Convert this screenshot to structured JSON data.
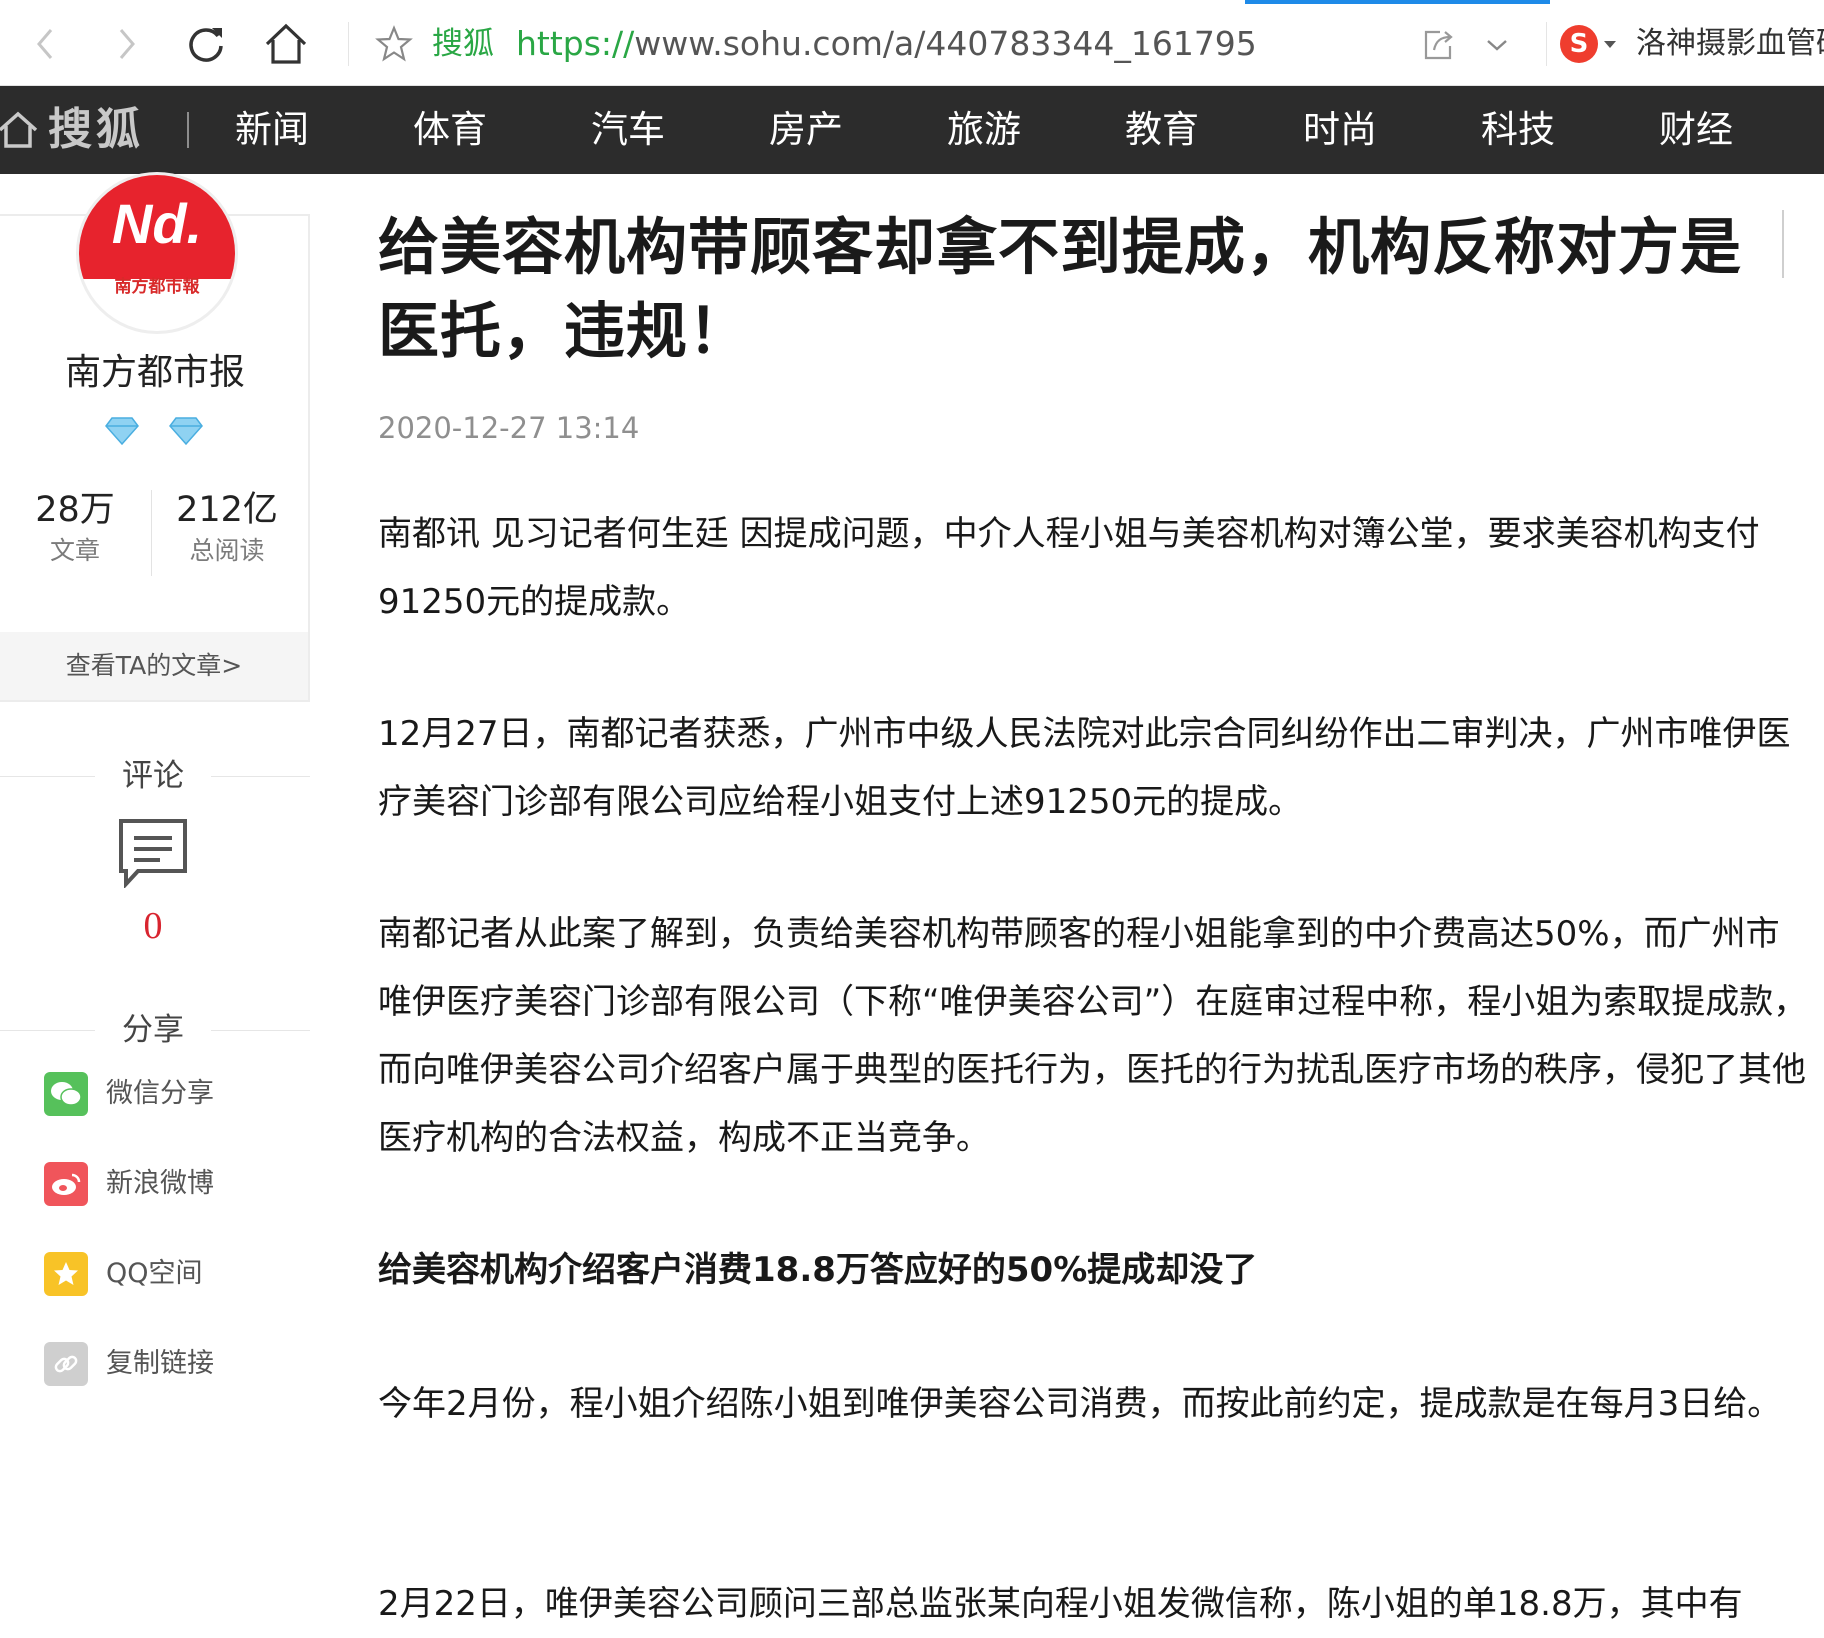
{
  "browser": {
    "site_name": "搜狐",
    "url_scheme": "https://",
    "url_rest": "www.sohu.com/a/440783344_161795",
    "search_text": "洛神摄影血管砥",
    "icons": [
      "back-icon",
      "forward-icon",
      "reload-icon",
      "home-icon",
      "star-icon",
      "share-icon",
      "chevron-down-icon",
      "sogou-icon"
    ],
    "colors": {
      "site_green": "#2aa745",
      "progress_blue": "#1e8ae8",
      "sogou_red": "#ef3d2e"
    }
  },
  "nav": {
    "logo": "搜狐",
    "items": [
      {
        "label": "新闻"
      },
      {
        "label": "体育"
      },
      {
        "label": "汽车"
      },
      {
        "label": "房产"
      },
      {
        "label": "旅游"
      },
      {
        "label": "教育"
      },
      {
        "label": "时尚"
      },
      {
        "label": "科技"
      },
      {
        "label": "财经"
      }
    ],
    "background": "#2c2c2c"
  },
  "author": {
    "avatar_mark": "Nd.",
    "avatar_subtitle": "南方都市報",
    "name": "南方都市报",
    "badge_count": 2,
    "stats": [
      {
        "value": "28万",
        "label": "文章"
      },
      {
        "value": "212亿",
        "label": "总阅读"
      }
    ],
    "view_articles": "查看TA的文章>"
  },
  "comments": {
    "heading": "评论",
    "count": "0"
  },
  "share": {
    "heading": "分享",
    "items": [
      {
        "label": "微信分享",
        "icon": "wechat-icon",
        "color": "#56c15b"
      },
      {
        "label": "新浪微博",
        "icon": "weibo-icon",
        "color": "#f0555b"
      },
      {
        "label": "QQ空间",
        "icon": "qzone-icon",
        "color": "#f8c327"
      },
      {
        "label": "复制链接",
        "icon": "link-icon",
        "color": "#cfcfcf"
      }
    ]
  },
  "article": {
    "title": "给美容机构带顾客却拿不到提成，机构反称对方是医托，违规！",
    "time": "2020-12-27 13:14",
    "paragraphs": [
      "南都讯 见习记者何生廷 因提成问题，中介人程小姐与美容机构对簿公堂，要求美容机构支付91250元的提成款。",
      "12月27日，南都记者获悉，广州市中级人民法院对此宗合同纠纷作出二审判决，广州市唯伊医疗美容门诊部有限公司应给程小姐支付上述91250元的提成。",
      "南都记者从此案了解到，负责给美容机构带顾客的程小姐能拿到的中介费高达50%，而广州市唯伊医疗美容门诊部有限公司（下称“唯伊美容公司”）在庭审过程中称，程小姐为索取提成款，而向唯伊美容公司介绍客户属于典型的医托行为，医托的行为扰乱医疗市场的秩序，侵犯了其他医疗机构的合法权益，构成不正当竞争。",
      "给美容机构介绍客户消费18.8万答应好的50%提成却没了",
      "今年2月份，程小姐介绍陈小姐到唯伊美容公司消费，而按此前约定，提成款是在每月3日给。",
      "2月22日，唯伊美容公司顾问三部总监张某向程小姐发微信称，陈小姐的单18.8万，其中有"
    ]
  }
}
